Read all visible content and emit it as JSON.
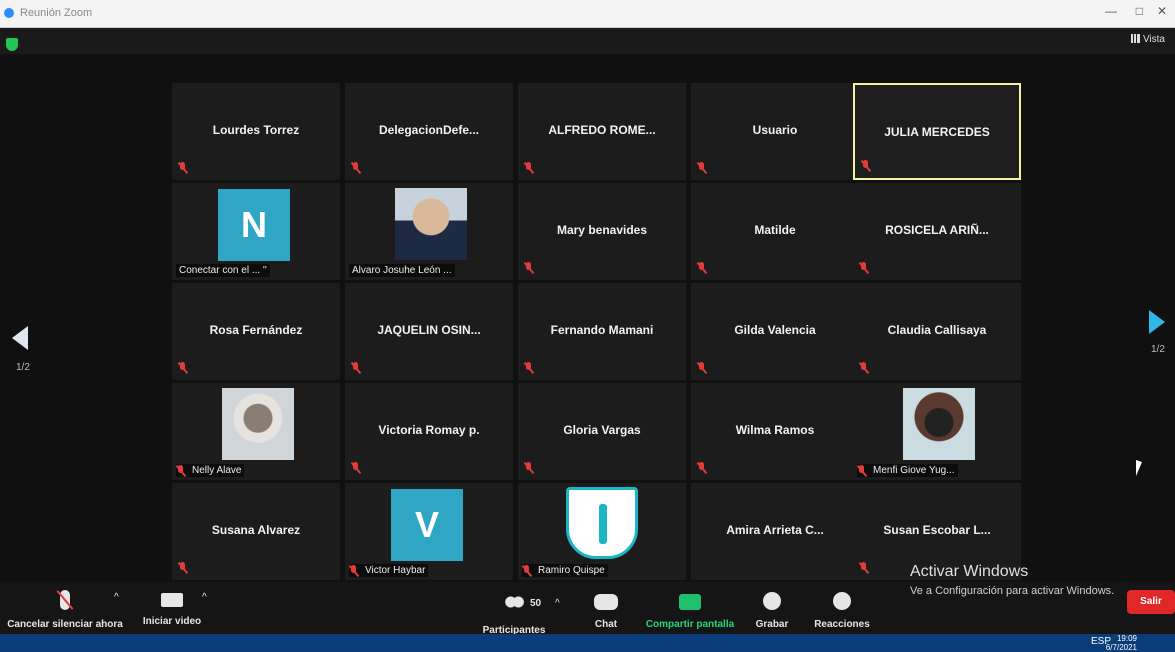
{
  "window": {
    "title": "Reunión Zoom",
    "controls": [
      "—",
      "□",
      "✕"
    ]
  },
  "topbar": {
    "view_label": "Vista"
  },
  "pagination": {
    "left": "1/2",
    "right": "1/2"
  },
  "tiles": [
    {
      "name": "Lourdes Torrez",
      "muted": true
    },
    {
      "name": "DelegacionDefe...",
      "muted": true
    },
    {
      "name": "ALFREDO ROME...",
      "muted": true
    },
    {
      "name": "Usuario",
      "muted": true
    },
    {
      "name": "JULIA MERCEDES",
      "muted": true,
      "active": true
    },
    {
      "name": "Conectar con el ... ''",
      "avatar_letter": "N",
      "corner": true
    },
    {
      "name": "Alvaro Josuhe León ...",
      "photo": "alvaro",
      "corner": true
    },
    {
      "name": "Mary benavides",
      "muted": true
    },
    {
      "name": "Matilde",
      "muted": true
    },
    {
      "name": "ROSICELA ARIÑ...",
      "muted": true
    },
    {
      "name": "Rosa Fernández",
      "muted": true
    },
    {
      "name": "JAQUELIN OSIN...",
      "muted": true
    },
    {
      "name": "Fernando Mamani",
      "muted": true
    },
    {
      "name": "Gilda Valencia",
      "muted": true
    },
    {
      "name": "Claudia Callisaya",
      "muted": true
    },
    {
      "name": "Nelly Alave",
      "photo": "nelly",
      "corner": true,
      "muted": true
    },
    {
      "name": "Victoria Romay p.",
      "muted": true
    },
    {
      "name": "Gloria Vargas",
      "muted": true
    },
    {
      "name": "Wilma Ramos",
      "muted": true
    },
    {
      "name": "Menfi Giove Yug...",
      "photo": "menfi",
      "corner": true,
      "muted": true
    },
    {
      "name": "Susana Alvarez",
      "muted": true
    },
    {
      "name": "Victor Haybar",
      "avatar_letter": "V",
      "corner": true,
      "muted": true
    },
    {
      "name": "Ramiro Quispe",
      "photo": "ramiro",
      "corner": true,
      "muted": true
    },
    {
      "name": "Amira Arrieta C...",
      "muted": false
    },
    {
      "name": "Susan Escobar L...",
      "muted": true
    }
  ],
  "toolbar": {
    "mute_label": "Cancelar silenciar ahora",
    "video_label": "Iniciar video",
    "participants_label": "Participantes",
    "participants_count": "50",
    "chat_label": "Chat",
    "share_label": "Compartir pantalla",
    "record_label": "Grabar",
    "reactions_label": "Reacciones",
    "leave_label": "Salir",
    "caret": "^"
  },
  "watermark": {
    "title": "Activar Windows",
    "subtitle": "Ve a Configuración para activar Windows."
  },
  "taskbar": {
    "lang": "ESP",
    "time": "19:09",
    "date": "6/7/2021"
  },
  "colors": {
    "accent_active": "#f2f2a0",
    "muted_red": "#e23b3b",
    "share_green": "#1ec16a",
    "leave_red": "#e02828",
    "avatar_blue": "#2ea6c4"
  }
}
